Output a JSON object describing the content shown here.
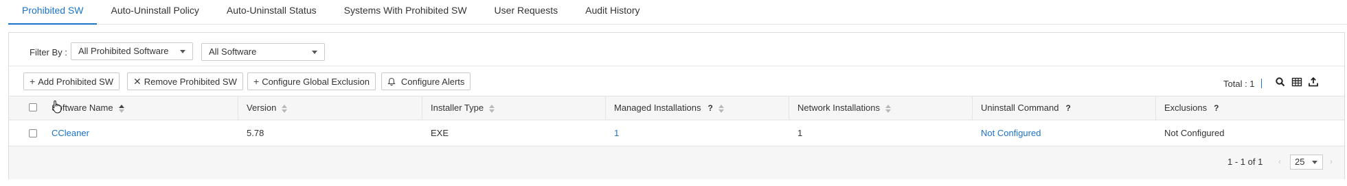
{
  "tabs": [
    {
      "label": "Prohibited SW",
      "active": true
    },
    {
      "label": "Auto-Uninstall Policy"
    },
    {
      "label": "Auto-Uninstall Status"
    },
    {
      "label": "Systems With Prohibited SW"
    },
    {
      "label": "User Requests"
    },
    {
      "label": "Audit History"
    }
  ],
  "filter": {
    "label": "Filter By :",
    "category_value": "All Prohibited Software",
    "software_value": "All Software"
  },
  "toolbar": {
    "add_label": "Add Prohibited SW",
    "remove_label": "Remove Prohibited SW",
    "exclusion_label": "Configure Global Exclusion",
    "alerts_label": "Configure Alerts",
    "total_text": "Total : 1",
    "icons": [
      "search-icon",
      "column-chooser-icon",
      "export-icon"
    ]
  },
  "table": {
    "columns": [
      {
        "label": "Software Name",
        "sort": "asc"
      },
      {
        "label": "Version",
        "sort": "both"
      },
      {
        "label": "Installer Type",
        "sort": "both"
      },
      {
        "label": "Managed Installations",
        "help": "?",
        "sort": "both"
      },
      {
        "label": "Network Installations",
        "sort": "both"
      },
      {
        "label": "Uninstall Command",
        "help": "?"
      },
      {
        "label": "Exclusions",
        "help": "?"
      }
    ],
    "rows": [
      {
        "software_name": "CCleaner",
        "version": "5.78",
        "installer_type": "EXE",
        "managed_installations": "1",
        "network_installations": "1",
        "uninstall_command": "Not Configured",
        "exclusions": "Not Configured"
      }
    ]
  },
  "pagination": {
    "range_text": "1 - 1 of 1",
    "page_size": "25"
  },
  "colors": {
    "accent": "#1a73c9",
    "header_bg": "#f6f6f6",
    "border": "#e3e3e3"
  }
}
